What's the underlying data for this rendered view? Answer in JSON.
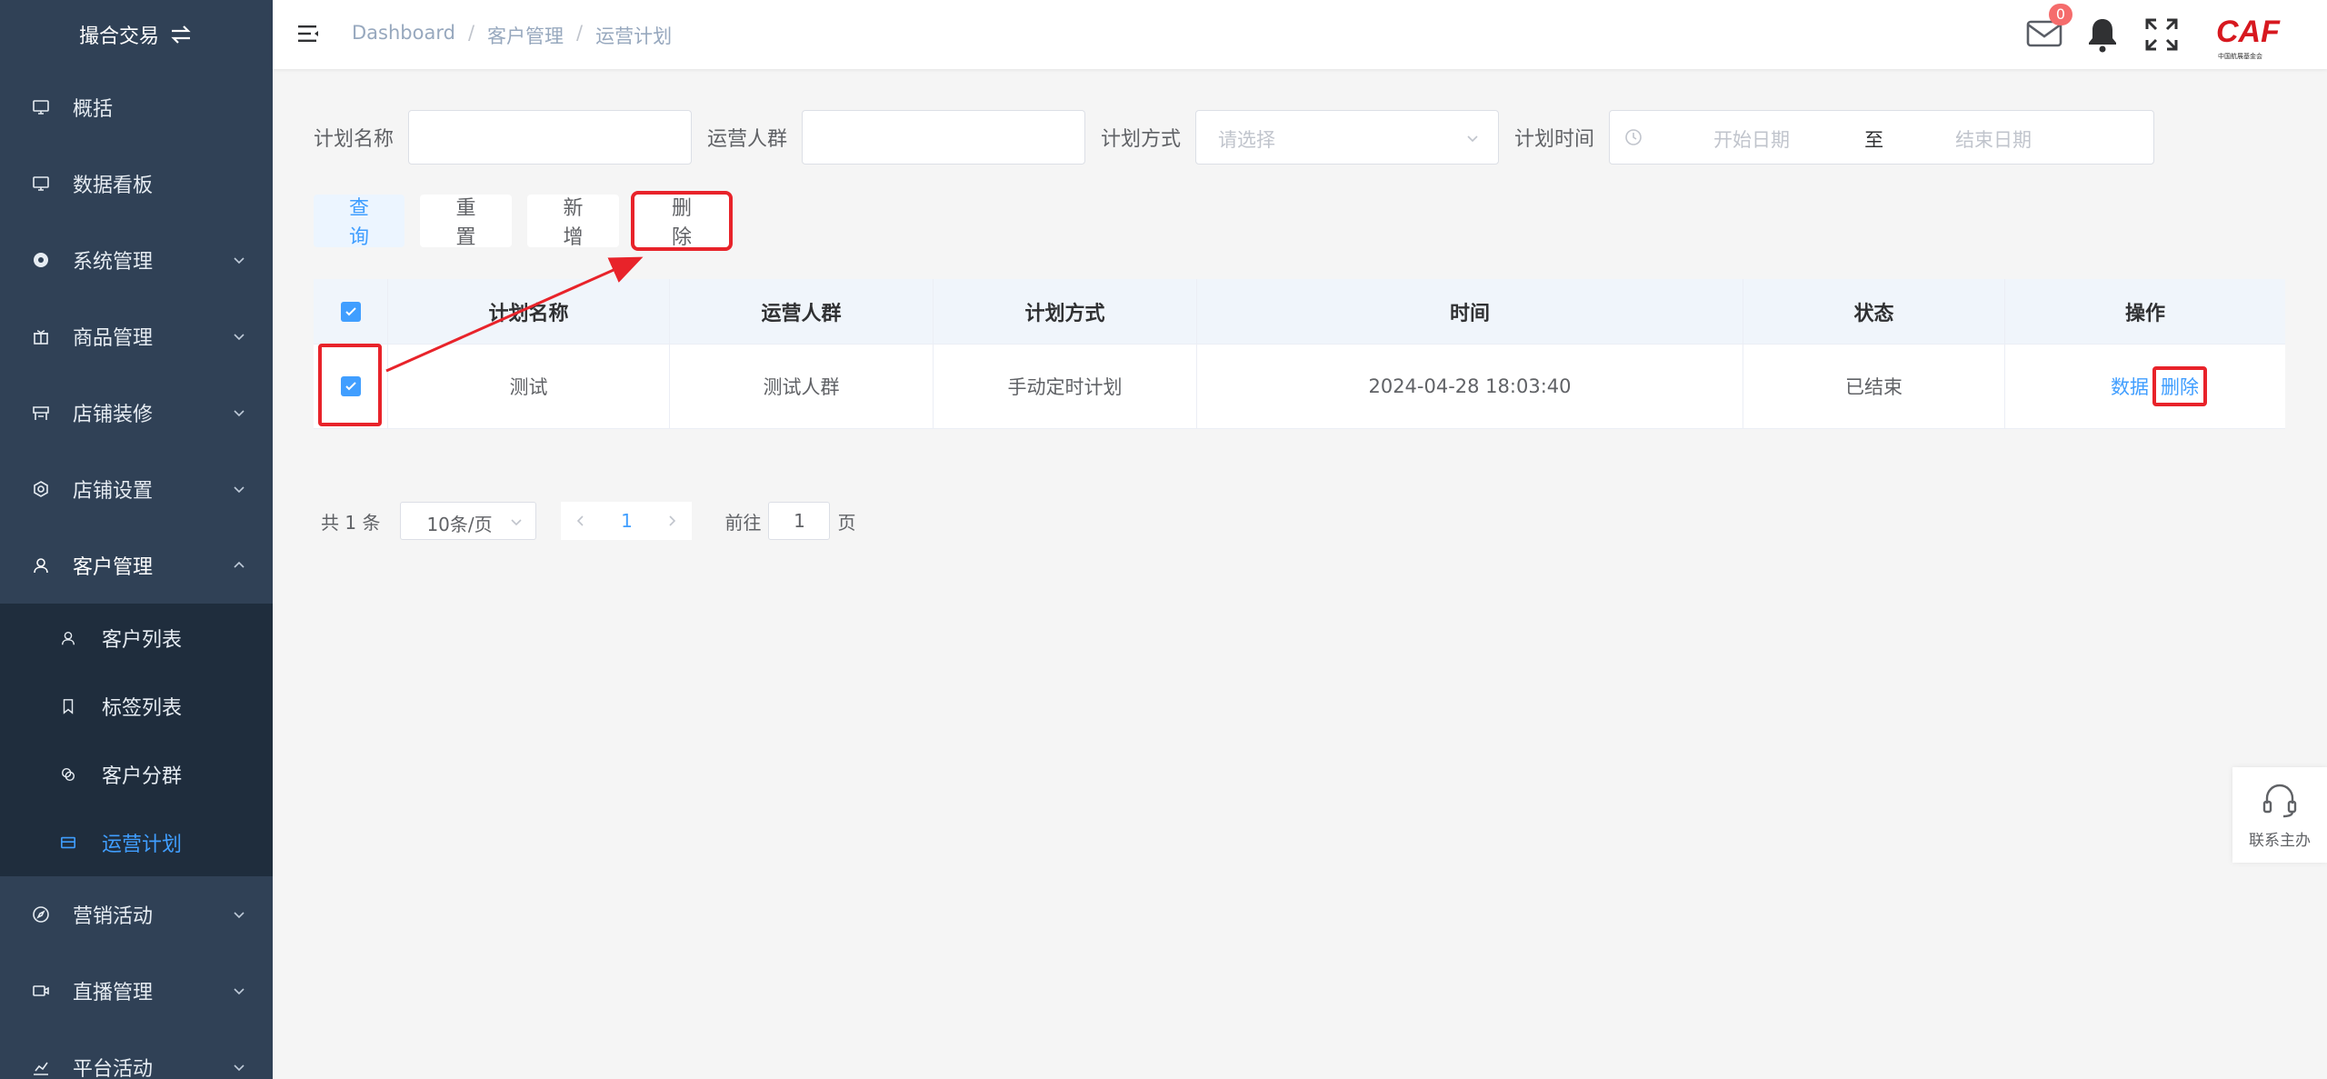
{
  "sidebar": {
    "brand": "撮合交易",
    "items": [
      {
        "label": "概括",
        "icon": "monitor-icon"
      },
      {
        "label": "数据看板",
        "icon": "monitor-icon"
      },
      {
        "label": "系统管理",
        "icon": "gear-circle-icon"
      },
      {
        "label": "商品管理",
        "icon": "gift-icon"
      },
      {
        "label": "店铺装修",
        "icon": "shop-icon"
      },
      {
        "label": "店铺设置",
        "icon": "settings-icon"
      },
      {
        "label": "客户管理",
        "icon": "user-icon"
      }
    ],
    "sub_items": [
      {
        "label": "客户列表",
        "icon": "user-icon"
      },
      {
        "label": "标签列表",
        "icon": "bookmark-icon"
      },
      {
        "label": "客户分群",
        "icon": "group-icon"
      },
      {
        "label": "运营计划",
        "icon": "card-icon"
      }
    ],
    "items_after": [
      {
        "label": "营销活动",
        "icon": "compass-icon"
      },
      {
        "label": "直播管理",
        "icon": "camera-icon"
      },
      {
        "label": "平台活动",
        "icon": "chart-icon"
      }
    ]
  },
  "header": {
    "breadcrumb": [
      "Dashboard",
      "客户管理",
      "运营计划"
    ],
    "mail_badge": "0",
    "logo_text": "CAF",
    "logo_sub": "中国航展基金会"
  },
  "filters": {
    "plan_name_label": "计划名称",
    "crowd_label": "运营人群",
    "method_label": "计划方式",
    "method_placeholder": "请选择",
    "time_label": "计划时间",
    "start_placeholder": "开始日期",
    "range_sep": "至",
    "end_placeholder": "结束日期"
  },
  "buttons": {
    "query": "查询",
    "reset": "重置",
    "add": "新增",
    "delete": "删除"
  },
  "table": {
    "columns": [
      "计划名称",
      "运营人群",
      "计划方式",
      "时间",
      "状态",
      "操作"
    ],
    "rows": [
      {
        "name": "测试",
        "crowd": "测试人群",
        "method": "手动定时计划",
        "time": "2024-04-28 18:03:40",
        "status": "已结束",
        "op_data": "数据",
        "op_delete": "删除"
      }
    ]
  },
  "pagination": {
    "total": "共 1 条",
    "page_size": "10条/页",
    "current": "1",
    "goto_prefix": "前往",
    "goto_value": "1",
    "goto_suffix": "页"
  },
  "float_contact": "联系主办",
  "colors": {
    "sidebar_bg": "#304156",
    "submenu_bg": "#1f2d3d",
    "primary": "#409eff",
    "highlight_red": "#e8232a"
  }
}
